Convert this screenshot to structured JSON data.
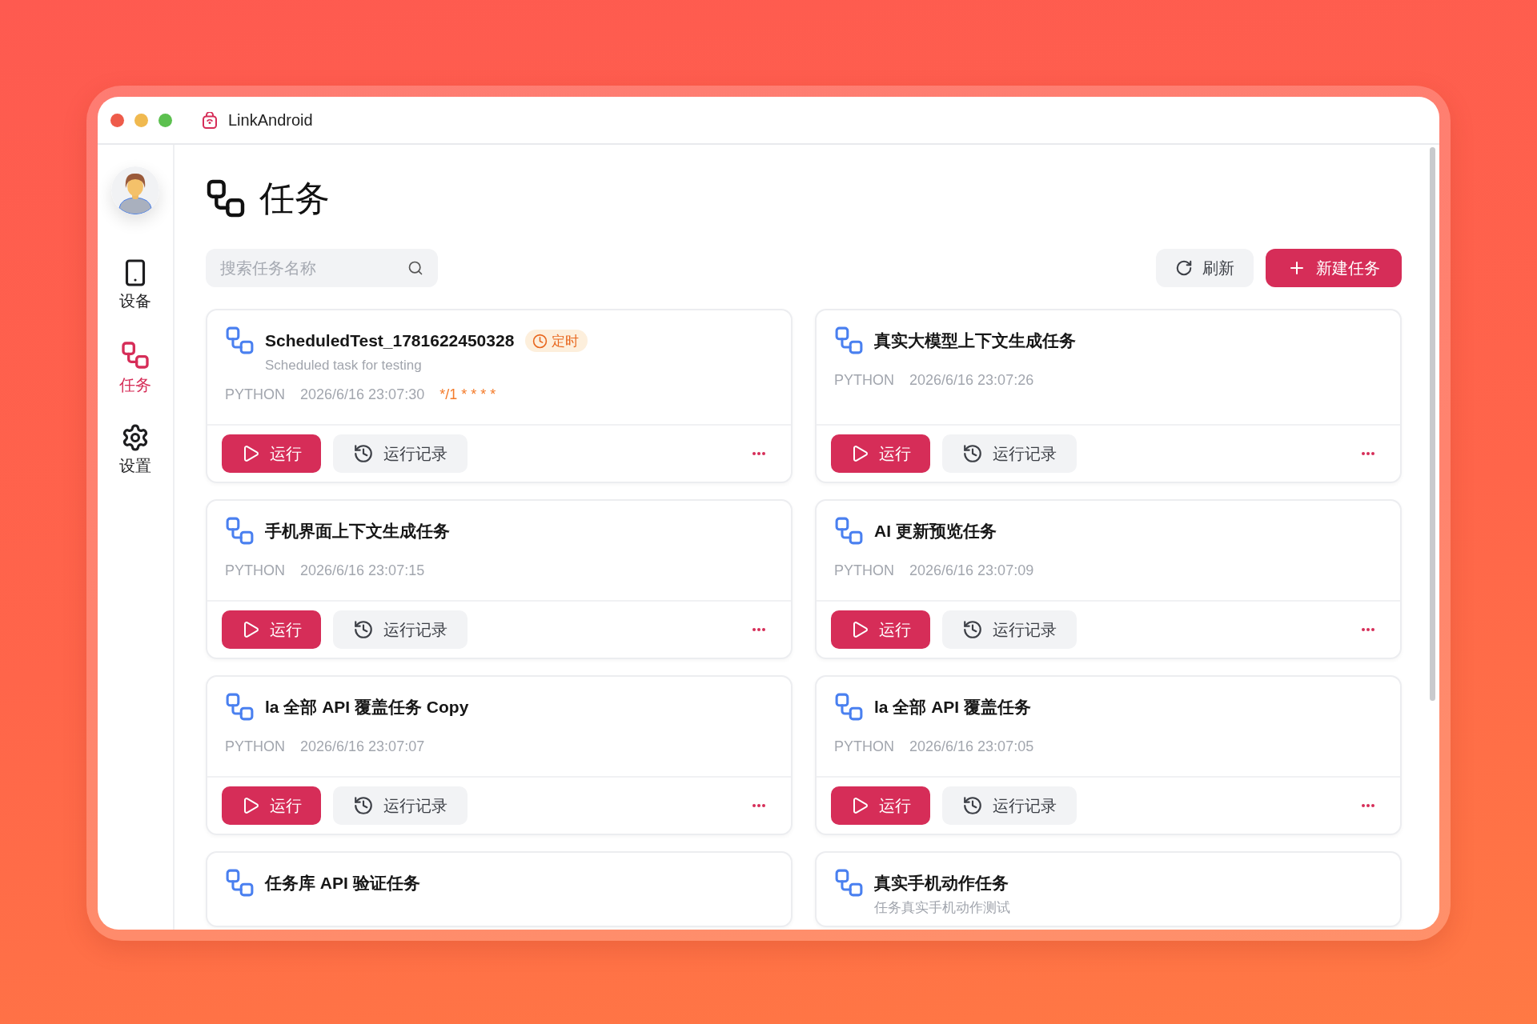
{
  "window": {
    "title": "LinkAndroid"
  },
  "sidebar": {
    "items": [
      {
        "label": "设备",
        "kind": "device",
        "selected": false
      },
      {
        "label": "任务",
        "kind": "tasks",
        "selected": true
      },
      {
        "label": "设置",
        "kind": "settings",
        "selected": false
      }
    ]
  },
  "page": {
    "title": "任务"
  },
  "search": {
    "placeholder": "搜索任务名称"
  },
  "toolbar": {
    "buttons": [
      {
        "label": "刷新",
        "kind": "refresh"
      },
      {
        "label": "新建任务",
        "kind": "create"
      }
    ]
  },
  "tasks": [
    {
      "name": "ScheduledTest_1781622450328",
      "badge": "定时",
      "description": "Scheduled task for testing",
      "language": "PYTHON",
      "created_at": "2026/6/16 23:07:30",
      "schedule": "*/1 * * * *",
      "actions": {
        "run": "运行",
        "history": "运行记录"
      }
    },
    {
      "name": "真实大模型上下文生成任务",
      "language": "PYTHON",
      "created_at": "2026/6/16 23:07:26",
      "actions": {
        "run": "运行",
        "history": "运行记录"
      }
    },
    {
      "name": "手机界面上下文生成任务",
      "language": "PYTHON",
      "created_at": "2026/6/16 23:07:15",
      "actions": {
        "run": "运行",
        "history": "运行记录"
      }
    },
    {
      "name": "AI 更新预览任务",
      "language": "PYTHON",
      "created_at": "2026/6/16 23:07:09",
      "actions": {
        "run": "运行",
        "history": "运行记录"
      }
    },
    {
      "name": "la 全部 API 覆盖任务 Copy",
      "language": "PYTHON",
      "created_at": "2026/6/16 23:07:07",
      "actions": {
        "run": "运行",
        "history": "运行记录"
      }
    },
    {
      "name": "la 全部 API 覆盖任务",
      "language": "PYTHON",
      "created_at": "2026/6/16 23:07:05",
      "actions": {
        "run": "运行",
        "history": "运行记录"
      }
    },
    {
      "name": "任务库 API 验证任务"
    },
    {
      "name": "真实手机动作任务",
      "description": "任务真实手机动作测试"
    }
  ]
}
